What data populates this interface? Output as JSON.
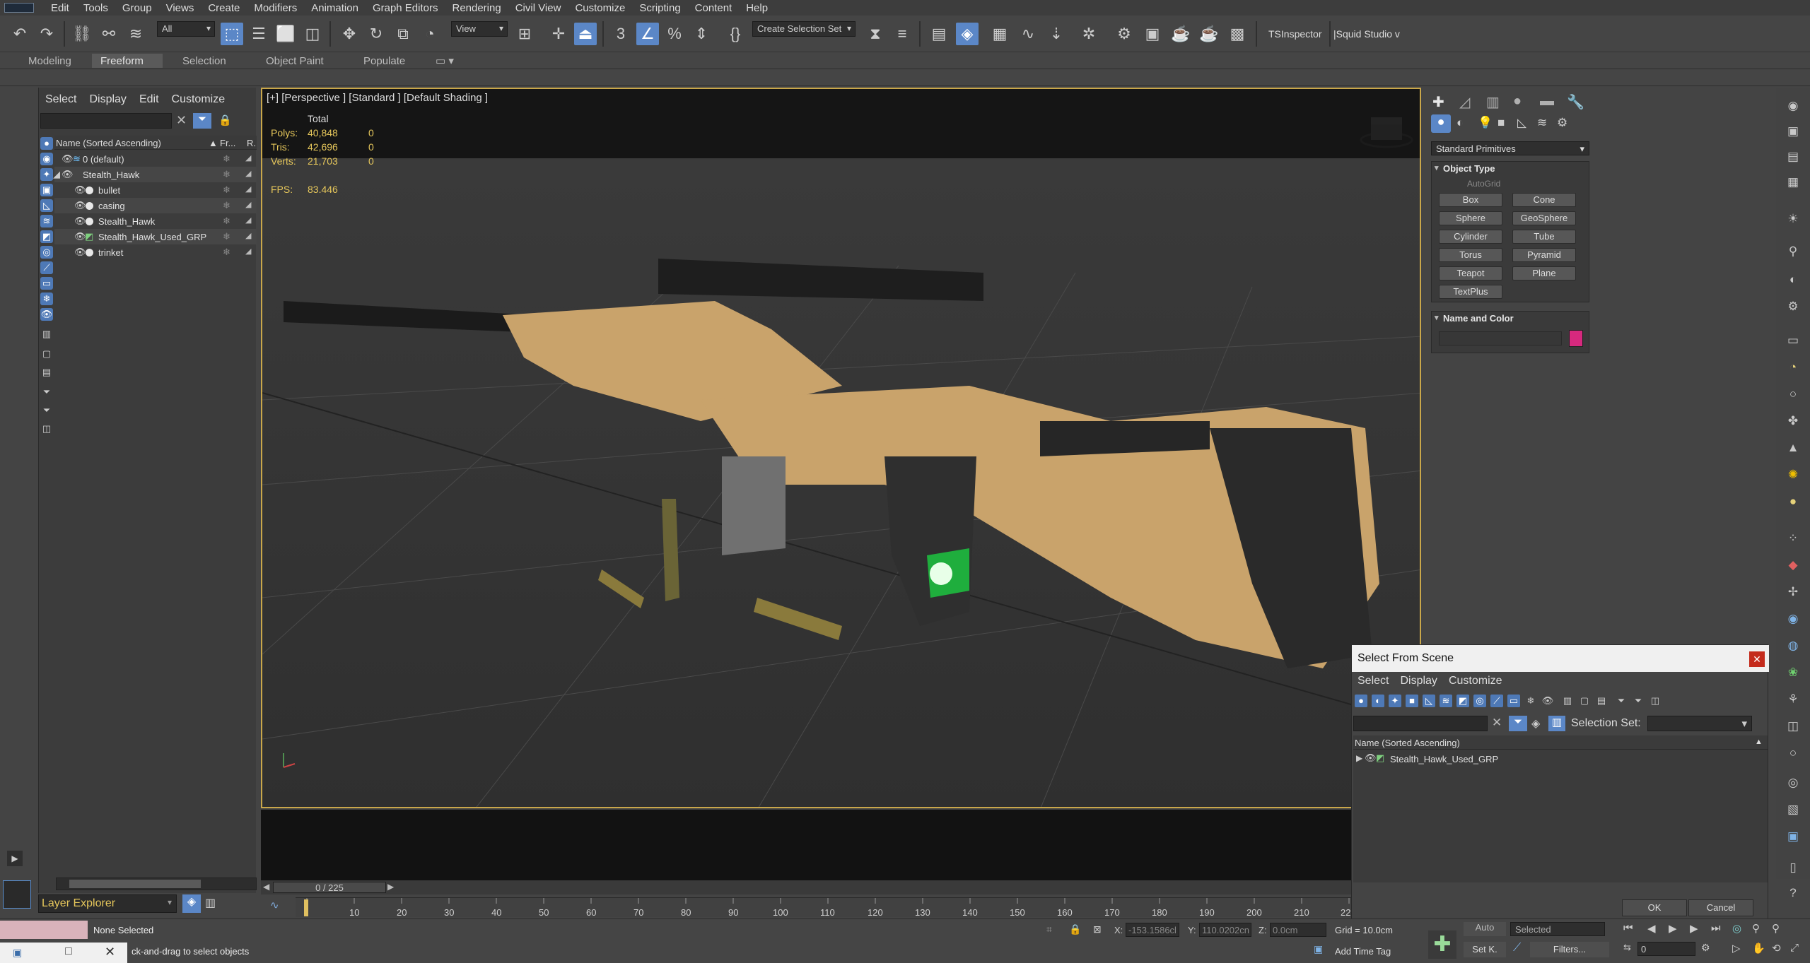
{
  "menu": [
    "Edit",
    "Tools",
    "Group",
    "Views",
    "Create",
    "Modifiers",
    "Animation",
    "Graph Editors",
    "Rendering",
    "Civil View",
    "Customize",
    "Scripting",
    "Content",
    "Help"
  ],
  "toolbar": {
    "filter_value": "All",
    "refcoord_value": "View",
    "selection_set_value": "Create Selection Set",
    "ts_inspector": "TSInspector",
    "squid_studio": "|Squid Studio v"
  },
  "ribbon_tabs": [
    "Modeling",
    "Freeform",
    "Selection",
    "Object Paint",
    "Populate"
  ],
  "explorer": {
    "menu": [
      "Select",
      "Display",
      "Edit",
      "Customize"
    ],
    "col_name": "Name (Sorted Ascending)",
    "col_fr": "Fr...",
    "col_r": "R.",
    "rows": [
      {
        "name": "0 (default)"
      },
      {
        "name": "Stealth_Hawk"
      },
      {
        "name": "bullet"
      },
      {
        "name": "casing"
      },
      {
        "name": "Stealth_Hawk"
      },
      {
        "name": "Stealth_Hawk_Used_GRP"
      },
      {
        "name": "trinket"
      }
    ],
    "layer_name": "Layer Explorer"
  },
  "viewport": {
    "label": "[+] [Perspective ] [Standard ] [Default Shading ]",
    "total": "Total",
    "polys_label": "Polys:",
    "polys": "40,848",
    "polys_sel": "0",
    "tris_label": "Tris:",
    "tris": "42,696",
    "tris_sel": "0",
    "verts_label": "Verts:",
    "verts": "21,703",
    "verts_sel": "0",
    "fps_label": "FPS:",
    "fps": "83.446"
  },
  "timeline": {
    "slider": "0 / 225",
    "ticks": [
      "10",
      "20",
      "30",
      "40",
      "50",
      "60",
      "70",
      "80",
      "90",
      "100",
      "110",
      "120",
      "130",
      "140",
      "150",
      "160",
      "170",
      "180",
      "190",
      "200",
      "210",
      "22"
    ]
  },
  "command_panel": {
    "category": "Standard Primitives",
    "object_type": "Object Type",
    "autogrid": "AutoGrid",
    "buttons": [
      "Box",
      "Cone",
      "Sphere",
      "GeoSphere",
      "Cylinder",
      "Tube",
      "Torus",
      "Pyramid",
      "Teapot",
      "Plane",
      "TextPlus"
    ],
    "name_and_color": "Name and Color",
    "object_color": "#d6297e"
  },
  "dialog": {
    "title": "Select From Scene",
    "menu": [
      "Select",
      "Display",
      "Customize"
    ],
    "selection_set_label": "Selection Set:",
    "col_name": "Name (Sorted Ascending)",
    "item": "Stealth_Hawk_Used_GRP",
    "ok": "OK",
    "cancel": "Cancel"
  },
  "status": {
    "none_selected": "None Selected",
    "prompt": "ck-and-drag to select objects",
    "x_label": "X:",
    "x": "-153.1586cl",
    "y_label": "Y:",
    "y": "110.0202cn",
    "z_label": "Z:",
    "z": "0.0cm",
    "grid": "Grid = 10.0cm",
    "add_time_tag": "Add Time Tag",
    "auto": "Auto",
    "selected": "Selected",
    "set_k": "Set K.",
    "filters": "Filters...",
    "frame": "0"
  }
}
